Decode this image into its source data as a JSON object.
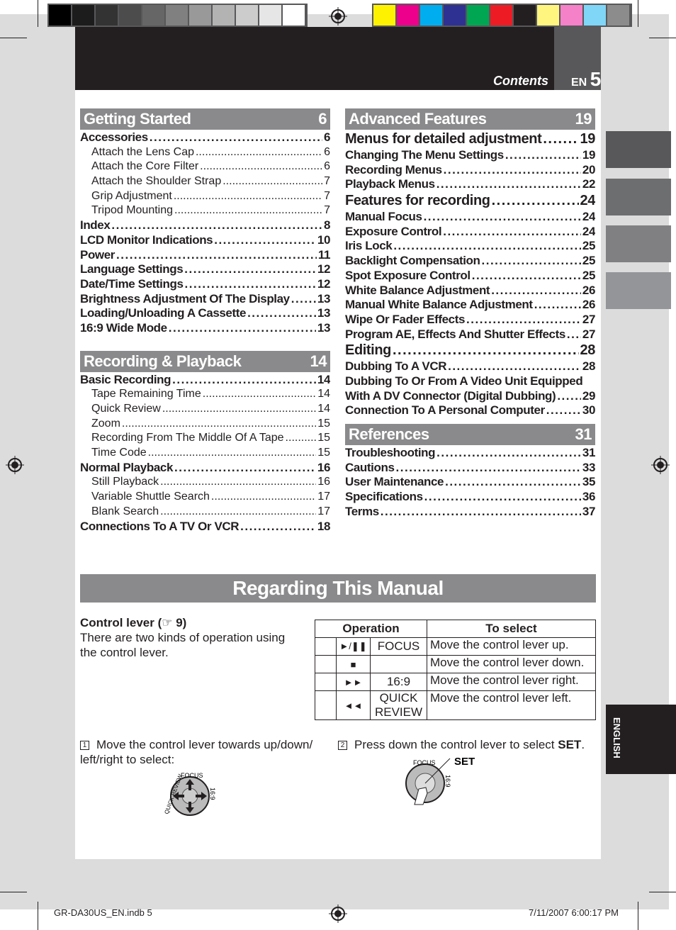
{
  "header": {
    "section": "Contents",
    "lang": "EN",
    "page": "5"
  },
  "colors": {
    "gray_bar": [
      "#000000",
      "#1c1c1c",
      "#333333",
      "#4c4c4c",
      "#666666",
      "#808080",
      "#999999",
      "#b3b3b3",
      "#cccccc",
      "#e6e6e6",
      "#ffffff"
    ],
    "color_bar": [
      "#fff200",
      "#ec008c",
      "#00aeef",
      "#2e3192",
      "#00a651",
      "#ed1c24",
      "#231f20",
      "#fff57f",
      "#f581c8",
      "#7fd6f7",
      "#8c8c8c"
    ],
    "section_bar": "#8a8a8c"
  },
  "left": [
    {
      "title": "Getting Started",
      "page": "6",
      "items": [
        {
          "l": 1,
          "t": "Accessories",
          "p": "6"
        },
        {
          "l": 2,
          "t": "Attach the Lens Cap",
          "p": "6"
        },
        {
          "l": 2,
          "t": "Attach the Core Filter",
          "p": "6"
        },
        {
          "l": 2,
          "t": "Attach the Shoulder Strap",
          "p": "7"
        },
        {
          "l": 2,
          "t": "Grip Adjustment",
          "p": "7"
        },
        {
          "l": 2,
          "t": "Tripod Mounting",
          "p": "7"
        },
        {
          "l": 1,
          "t": "Index",
          "p": "8"
        },
        {
          "l": 1,
          "t": "LCD Monitor Indications",
          "p": "10"
        },
        {
          "l": 1,
          "t": "Power",
          "p": "11"
        },
        {
          "l": 1,
          "t": "Language Settings",
          "p": "12"
        },
        {
          "l": 1,
          "t": "Date/Time Settings",
          "p": "12"
        },
        {
          "l": 1,
          "t": "Brightness Adjustment Of The Display",
          "p": "13"
        },
        {
          "l": 1,
          "t": "Loading/Unloading A Cassette",
          "p": "13"
        },
        {
          "l": 1,
          "t": "16:9 Wide Mode",
          "p": "13"
        }
      ]
    },
    {
      "title": "Recording & Playback",
      "page": "14",
      "items": [
        {
          "l": 1,
          "t": "Basic Recording",
          "p": "14"
        },
        {
          "l": 2,
          "t": "Tape Remaining Time",
          "p": "14"
        },
        {
          "l": 2,
          "t": "Quick Review",
          "p": "14"
        },
        {
          "l": 2,
          "t": "Zoom",
          "p": "15"
        },
        {
          "l": 2,
          "t": "Recording From The Middle Of A Tape",
          "p": "15"
        },
        {
          "l": 2,
          "t": "Time Code",
          "p": "15"
        },
        {
          "l": 1,
          "t": "Normal Playback",
          "p": "16"
        },
        {
          "l": 2,
          "t": "Still Playback",
          "p": "16"
        },
        {
          "l": 2,
          "t": "Variable Shuttle Search",
          "p": "17"
        },
        {
          "l": 2,
          "t": "Blank Search",
          "p": "17"
        },
        {
          "l": 1,
          "t": "Connections To A TV Or VCR",
          "p": "18"
        }
      ]
    }
  ],
  "right": [
    {
      "title": "Advanced Features",
      "page": "19",
      "items": [
        {
          "l": 0,
          "t": "Menus for detailed adjustment",
          "p": "19"
        },
        {
          "l": 1,
          "t": "Changing The Menu Settings",
          "p": "19"
        },
        {
          "l": 1,
          "t": "Recording Menus",
          "p": "20"
        },
        {
          "l": 1,
          "t": "Playback Menus",
          "p": "22"
        },
        {
          "l": 0,
          "t": "Features for recording",
          "p": "24"
        },
        {
          "l": 1,
          "t": "Manual Focus",
          "p": "24"
        },
        {
          "l": 1,
          "t": "Exposure Control",
          "p": "24"
        },
        {
          "l": 1,
          "t": "Iris Lock",
          "p": "25"
        },
        {
          "l": 1,
          "t": "Backlight Compensation",
          "p": "25"
        },
        {
          "l": 1,
          "t": "Spot Exposure Control",
          "p": "25"
        },
        {
          "l": 1,
          "t": "White Balance Adjustment",
          "p": "26"
        },
        {
          "l": 1,
          "t": "Manual White Balance Adjustment",
          "p": "26"
        },
        {
          "l": 1,
          "t": "Wipe Or Fader Effects",
          "p": "27"
        },
        {
          "l": 1,
          "t": "Program AE, Effects And Shutter Effects",
          "p": "27"
        },
        {
          "l": 0,
          "t": "Editing",
          "p": "28"
        },
        {
          "l": 1,
          "t": "Dubbing To A VCR",
          "p": "28"
        },
        {
          "l": 3,
          "t": "Dubbing To Or From A Video Unit Equipped"
        },
        {
          "l": 1,
          "t": "With A DV Connector (Digital Dubbing)",
          "p": "29"
        },
        {
          "l": 1,
          "t": "Connection To A Personal Computer",
          "p": "30"
        }
      ]
    },
    {
      "title": "References",
      "page": "31",
      "items": [
        {
          "l": 1,
          "t": "Troubleshooting",
          "p": "31"
        },
        {
          "l": 1,
          "t": "Cautions",
          "p": "33"
        },
        {
          "l": 1,
          "t": "User Maintenance",
          "p": "35"
        },
        {
          "l": 1,
          "t": "Specifications",
          "p": "36"
        },
        {
          "l": 1,
          "t": "Terms",
          "p": "37"
        }
      ]
    }
  ],
  "manual": {
    "title": "Regarding This Manual",
    "control_label": "Control lever (",
    "control_ref_icon": "☞",
    "control_ref": " 9)",
    "control_desc": "There are two kinds of operation using the control lever.",
    "table": {
      "headers": [
        "Operation",
        "To select"
      ],
      "rows": [
        [
          "►/❚❚",
          "FOCUS",
          "Move the control lever up."
        ],
        [
          "■",
          "",
          "Move the control lever down."
        ],
        [
          "►►",
          "16:9",
          "Move the control lever right."
        ],
        [
          "◄◄",
          "QUICK REVIEW",
          "Move the control lever left."
        ]
      ]
    },
    "step1_num": "1",
    "step1": "Move the control lever towards up/down/ left/right to select:",
    "step2_num": "2",
    "step2": "Press down the control lever to select ",
    "step2_bold": "SET",
    "step2_end": ".",
    "dial_labels": {
      "focus": "FOCUS",
      "quick": "QUICK REVIEW",
      "wide": "16:9",
      "set": "SET",
      "quick_cut": "ICK REVIEW"
    }
  },
  "side_tab": "ENGLISH",
  "footer": {
    "file": "GR-DA30US_EN.indb   5",
    "date": "7/11/2007   6:00:17 PM"
  }
}
